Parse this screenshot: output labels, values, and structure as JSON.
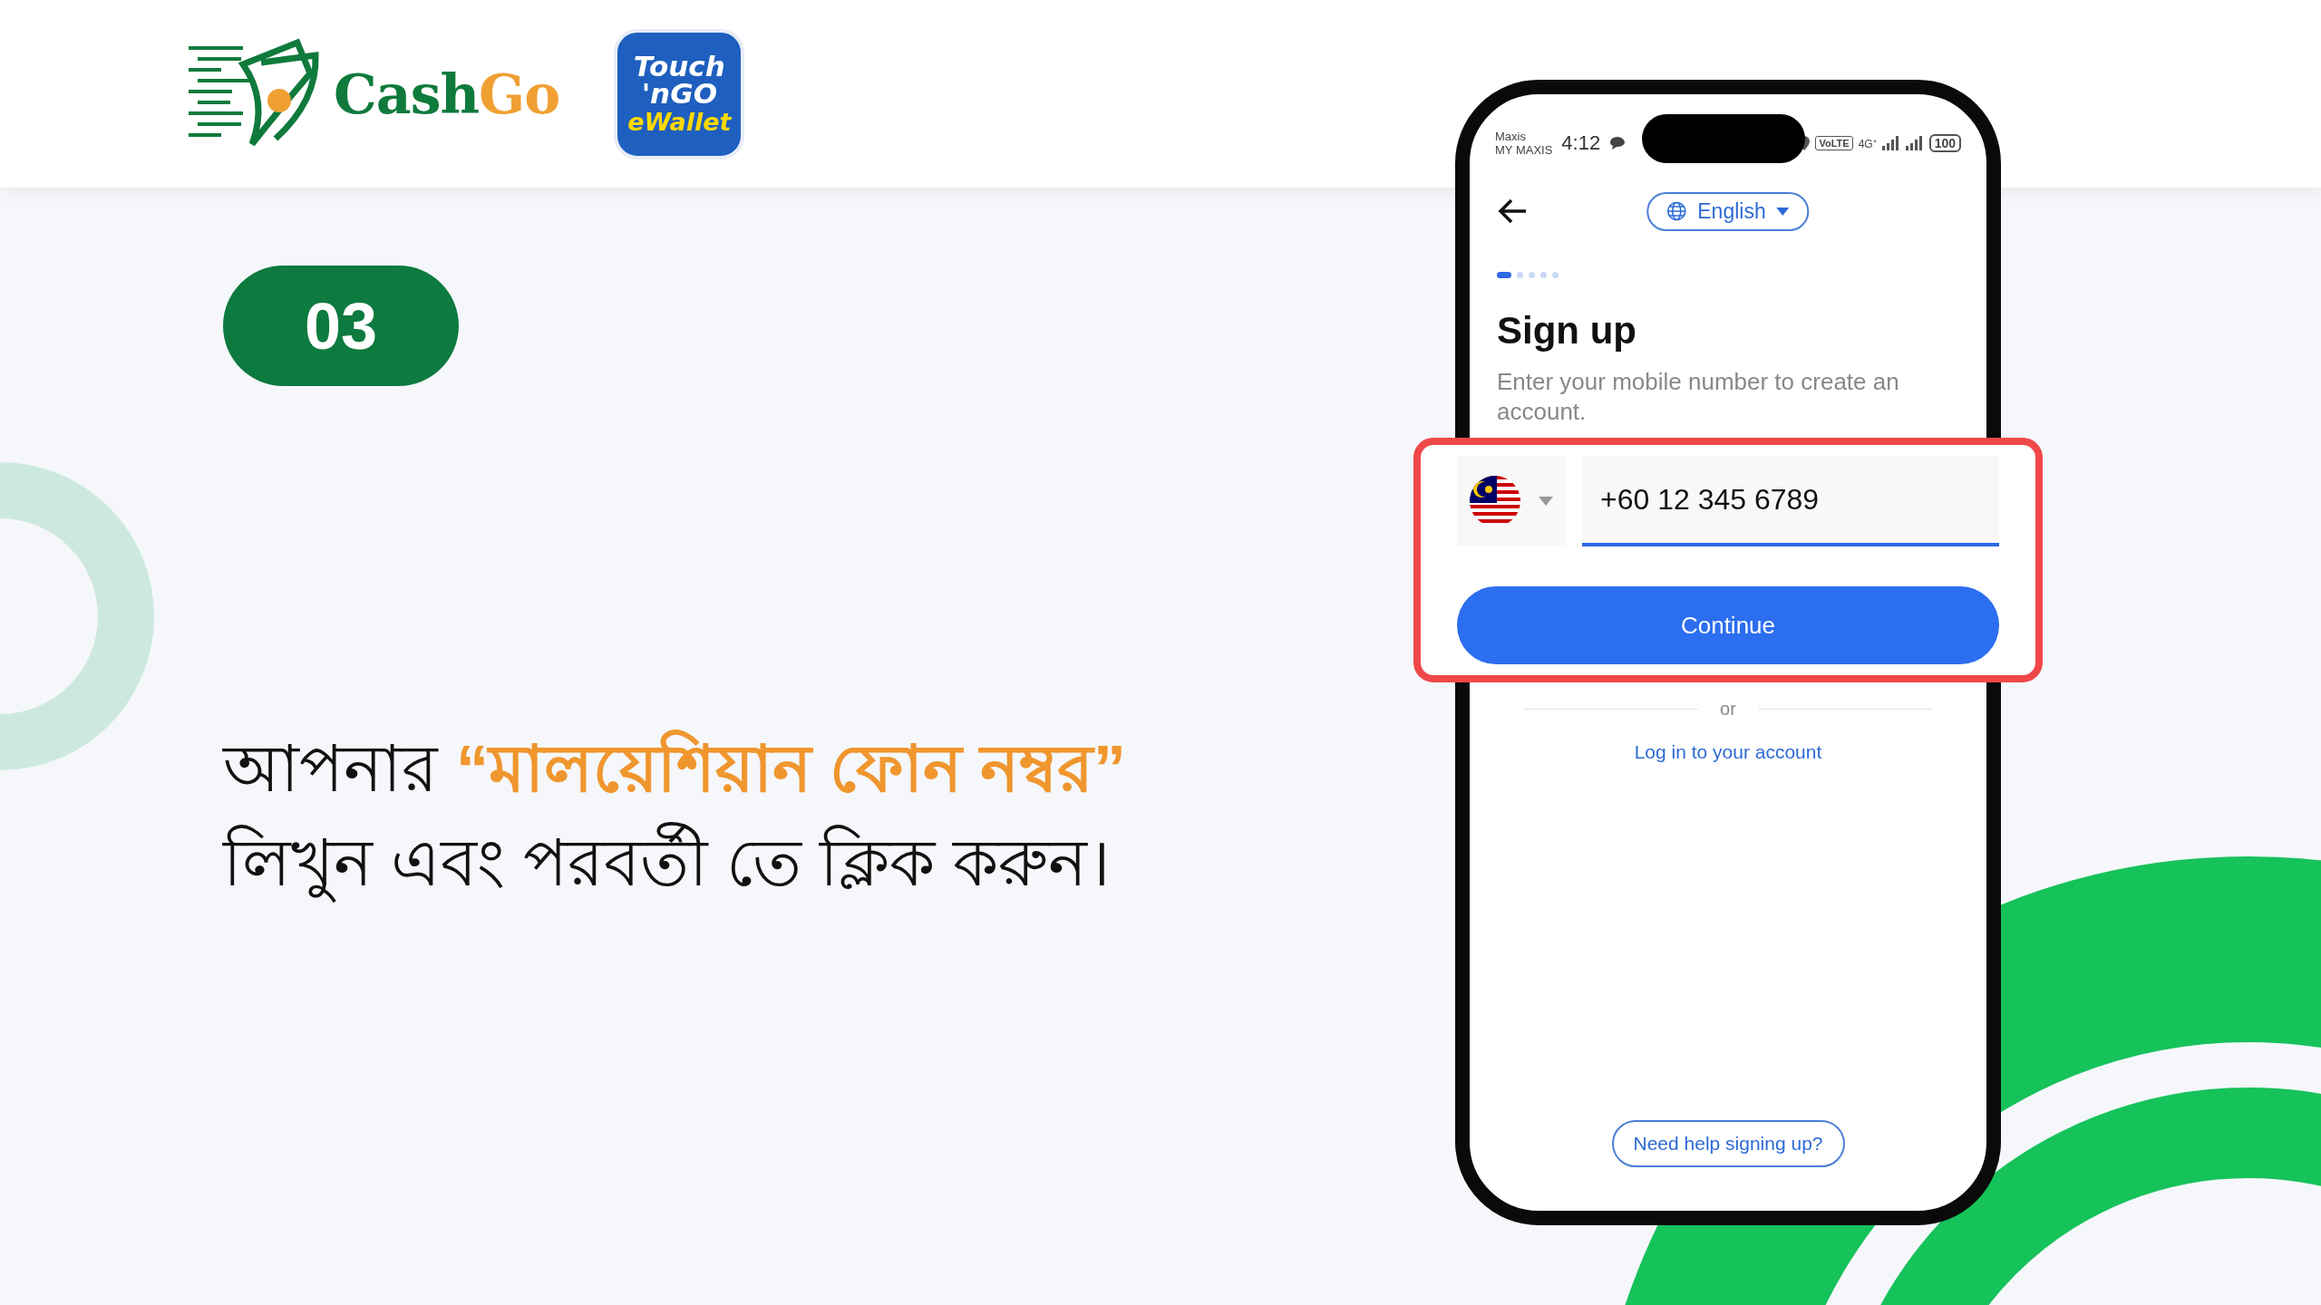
{
  "header": {
    "cashgo_logo": {
      "parts": [
        "Cash",
        "Go"
      ]
    },
    "tng_logo": {
      "lines": [
        "Touch",
        "'nGO",
        "eWallet"
      ]
    }
  },
  "step_badge": "03",
  "instruction": [
    {
      "text": "আপনার ",
      "highlight": false
    },
    {
      "text": "“মালয়েশিয়ান ফোন নম্বর”",
      "highlight": true
    },
    {
      "text": " লিখুন এবং পরবর্তী তে ক্লিক করুন।",
      "highlight": false
    }
  ],
  "phone": {
    "status_bar": {
      "carrier": "Maxis",
      "operator": "MY MAXIS",
      "time": "4:12",
      "network": "VoLTE",
      "signal_type": "4G⁺",
      "battery": "100"
    },
    "language": "English",
    "steps": [
      {
        "selected": true
      },
      {
        "selected": false
      },
      {
        "selected": false
      },
      {
        "selected": false
      },
      {
        "selected": false
      }
    ],
    "title": "Sign up",
    "subtitle": "Enter your mobile number to create an account.",
    "phone_number": "+60 12 345 6789",
    "continue_button": "Continue",
    "divider_text": "or",
    "login_link": "Log in to your account",
    "help_button": "Need help signing up?"
  }
}
